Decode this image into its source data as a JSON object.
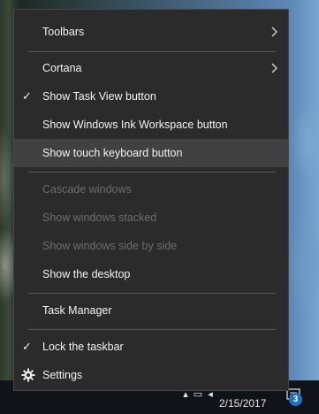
{
  "context_menu": {
    "items": [
      {
        "label": "Toolbars",
        "has_submenu": true
      },
      {
        "label": "Cortana",
        "has_submenu": true
      },
      {
        "label": "Show Task View button",
        "checked": true
      },
      {
        "label": "Show Windows Ink Workspace button"
      },
      {
        "label": "Show touch keyboard button",
        "highlighted": true
      },
      {
        "label": "Cascade windows",
        "disabled": true
      },
      {
        "label": "Show windows stacked",
        "disabled": true
      },
      {
        "label": "Show windows side by side",
        "disabled": true
      },
      {
        "label": "Show the desktop"
      },
      {
        "label": "Task Manager"
      },
      {
        "label": "Lock the taskbar",
        "checked": true
      },
      {
        "label": "Settings",
        "icon": "gear-icon"
      }
    ]
  },
  "taskbar": {
    "date": "2/15/2017",
    "notification_count": "3"
  },
  "colors": {
    "menu_bg": "#2b2b2b",
    "highlight_bg": "#414141",
    "disabled_text": "#6d6d6d",
    "text": "#f2f2f2",
    "badge": "#1f6fd1"
  }
}
